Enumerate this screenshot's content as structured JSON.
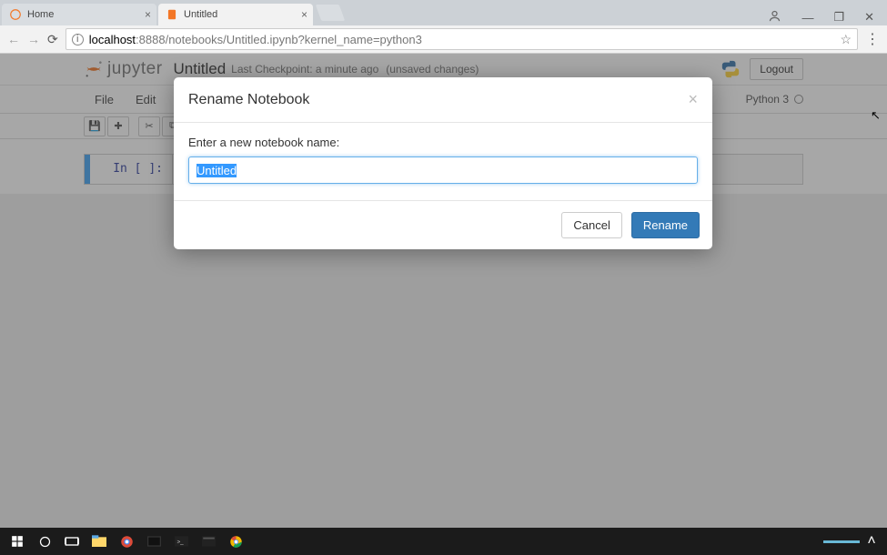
{
  "browser": {
    "tabs": [
      {
        "label": "Home",
        "active": false
      },
      {
        "label": "Untitled",
        "active": true
      }
    ],
    "url_host": "localhost",
    "url_rest": ":8888/notebooks/Untitled.ipynb?kernel_name=python3"
  },
  "jupyter": {
    "brand": "jupyter",
    "notebook_title": "Untitled",
    "checkpoint": "Last Checkpoint: a minute ago",
    "unsaved": "(unsaved changes)",
    "logout": "Logout",
    "menus": [
      "File",
      "Edit"
    ],
    "kernel_label": "Python 3",
    "cell_prompt": "In [ ]:"
  },
  "modal": {
    "title": "Rename Notebook",
    "label": "Enter a new notebook name:",
    "value": "Untitled",
    "cancel": "Cancel",
    "rename": "Rename"
  }
}
